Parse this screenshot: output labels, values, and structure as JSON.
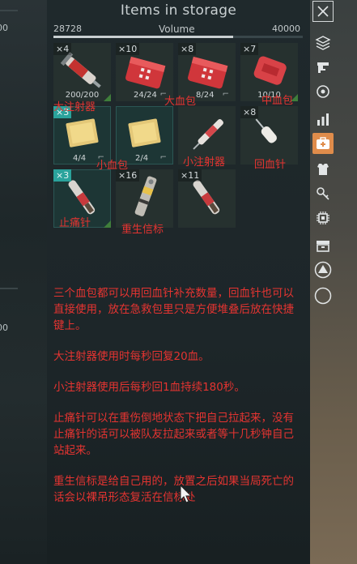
{
  "header": {
    "title": "Items in storage"
  },
  "volume": {
    "min": "28728",
    "label": "Volume",
    "max": "40000",
    "fill_fraction": 0.72
  },
  "left_edge": {
    "text_top": "00",
    "text_bottom": "00"
  },
  "slots": [
    {
      "count": "×4",
      "durability": "200/200",
      "annotation": "大注射器"
    },
    {
      "count": "×10",
      "durability": "24/24",
      "annotation": "大血包"
    },
    {
      "count": "×8",
      "durability": "8/24",
      "annotation": ""
    },
    {
      "count": "×7",
      "durability": "10/10",
      "annotation": "中血包"
    },
    {
      "count": "×3",
      "durability": "4/4",
      "annotation": "小血包"
    },
    {
      "count": "",
      "durability": "2/4",
      "annotation": ""
    },
    {
      "count": "",
      "durability": "",
      "annotation": "小注射器"
    },
    {
      "count": "×8",
      "durability": "",
      "annotation": "回血针"
    },
    {
      "count": "×3",
      "durability": "",
      "annotation": "止痛针"
    },
    {
      "count": "×16",
      "durability": "",
      "annotation": "重生信标"
    },
    {
      "count": "×11",
      "durability": "",
      "annotation": ""
    }
  ],
  "notes": [
    "三个血包都可以用回血针补充数量，回血针也可以直接使用，放在急救包里只是方便堆叠后放在快捷键上。",
    "大注射器使用时每秒回复20血。",
    "小注射器使用后每秒回1血持续180秒。",
    "止痛针可以在重伤倒地状态下把自己拉起来，没有止痛针的话可以被队友拉起来或者等十几秒钟自己站起来。",
    "重生信标是给自己用的，放置之后如果当局死亡的话会以裸吊形态复活在信标处"
  ],
  "sidebar": {
    "icons": [
      "close-icon",
      "layers-icon",
      "gun-icon",
      "target-icon",
      "stats-icon",
      "medkit-icon",
      "armor-icon",
      "keys-icon",
      "chip-icon",
      "storage-box-icon",
      "triangle-icon",
      "circle-icon"
    ],
    "active_index": 5
  },
  "colors": {
    "annotation_red": "#e53431",
    "teal_badge": "#2aa39c",
    "active_orange": "#e08c4b"
  }
}
